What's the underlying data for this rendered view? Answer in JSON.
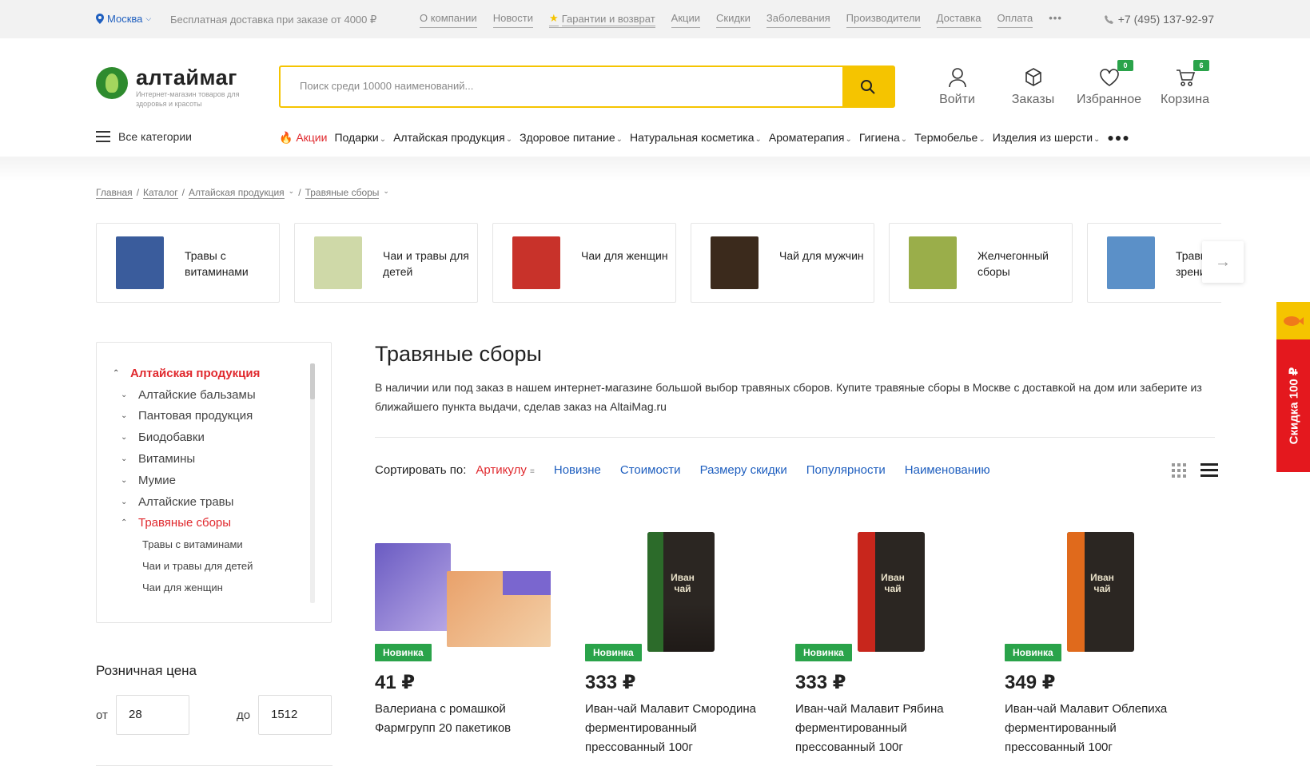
{
  "topbar": {
    "city": "Москва",
    "shipping": "Бесплатная доставка при заказе от 4000 ₽",
    "links": [
      "О компании",
      "Новости",
      "Гарантии и возврат",
      "Акции",
      "Скидки",
      "Заболевания",
      "Производители",
      "Доставка",
      "Оплата"
    ],
    "phone": "+7 (495) 137-92-97"
  },
  "header": {
    "logo_name": "алтаймаг",
    "logo_sub": "Интернет-магазин товаров для здоровья и красоты",
    "search_placeholder": "Поиск среди 10000 наименований...",
    "login": "Войти",
    "orders": "Заказы",
    "favorites": "Избранное",
    "favorites_count": "0",
    "cart": "Корзина",
    "cart_count": "6"
  },
  "nav": {
    "all_categories": "Все категории",
    "items": [
      "Акции",
      "Подарки",
      "Алтайская продукция",
      "Здоровое питание",
      "Натуральная косметика",
      "Ароматерапия",
      "Гигиена",
      "Термобелье",
      "Изделия из шерсти"
    ]
  },
  "breadcrumbs": [
    "Главная",
    "Каталог",
    "Алтайская продукция",
    "Травяные сборы"
  ],
  "subcategories": [
    {
      "name": "Травы с витаминами",
      "color": "#3a5c9c"
    },
    {
      "name": "Чаи и травы для детей",
      "color": "#cfd9a8"
    },
    {
      "name": "Чаи для женщин",
      "color": "#c8322a"
    },
    {
      "name": "Чай для мужчин",
      "color": "#3b2a1c"
    },
    {
      "name": "Желчегонный сборы",
      "color": "#9aae4a"
    },
    {
      "name": "Травы для зрения",
      "color": "#5b90c8"
    }
  ],
  "promo": {
    "label": "Скидка 100 ₽"
  },
  "sidebar": {
    "items": [
      {
        "label": "Алтайская продукция",
        "level": 1,
        "open": true,
        "active": true
      },
      {
        "label": "Алтайские бальзамы",
        "level": 1
      },
      {
        "label": "Пантовая продукция",
        "level": 1
      },
      {
        "label": "Биодобавки",
        "level": 1
      },
      {
        "label": "Витамины",
        "level": 1
      },
      {
        "label": "Мумие",
        "level": 1
      },
      {
        "label": "Алтайские травы",
        "level": 1
      },
      {
        "label": "Травяные сборы",
        "level": 1,
        "open": true,
        "active": true
      },
      {
        "label": "Травы с витаминами",
        "level": 2
      },
      {
        "label": "Чаи и травы для детей",
        "level": 2
      },
      {
        "label": "Чаи для женщин",
        "level": 2
      }
    ],
    "price_title": "Розничная цена",
    "from_label": "от",
    "from_value": "28",
    "to_label": "до",
    "to_value": "1512"
  },
  "main": {
    "title": "Травяные сборы",
    "description": "В наличии или под заказ в нашем интернет-магазине большой выбор травяных сборов. Купите травяные сборы в Москве с доставкой на дом или заберите из ближайшего пункта выдачи, сделав заказ на AltaiMag.ru",
    "sort_label": "Сортировать по:",
    "sort_options": [
      "Артикулу",
      "Новизне",
      "Стоимости",
      "Размеру скидки",
      "Популярности",
      "Наименованию"
    ]
  },
  "products": [
    {
      "badge": "Новинка",
      "price": "41 ₽",
      "name": "Валериана с ромашкой Фармгрупп 20 пакетиков",
      "pack_text": ""
    },
    {
      "badge": "Новинка",
      "price": "333 ₽",
      "name": "Иван-чай Малавит Смородина ферментированный прессованный 100г",
      "pack_text": "Иван чай",
      "accent": "#2c6b2a"
    },
    {
      "badge": "Новинка",
      "price": "333 ₽",
      "name": "Иван-чай Малавит Рябина ферментированный прессованный 100г",
      "pack_text": "Иван чай",
      "accent": "#c8261c"
    },
    {
      "badge": "Новинка",
      "price": "349 ₽",
      "name": "Иван-чай Малавит Облепиха ферментированный прессованный 100г",
      "pack_text": "Иван чай",
      "accent": "#e06a1c"
    }
  ]
}
